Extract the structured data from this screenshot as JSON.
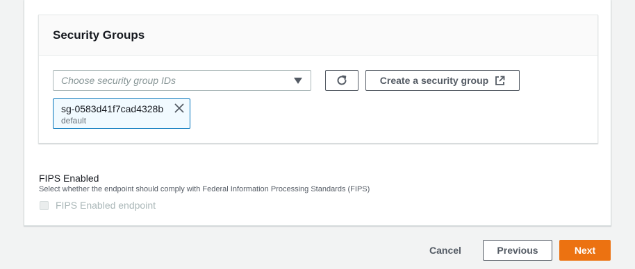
{
  "security_groups": {
    "title": "Security Groups",
    "select": {
      "placeholder": "Choose security group IDs"
    },
    "refresh_icon": "refresh-icon",
    "create_button": {
      "label": "Create a security group",
      "icon": "external-link-icon"
    },
    "selected_tokens": [
      {
        "id": "sg-0583d41f7cad4328b",
        "description": "default",
        "remove_icon": "close-icon"
      }
    ]
  },
  "fips": {
    "title": "FIPS Enabled",
    "description": "Select whether the endpoint should comply with Federal Information Processing Standards (FIPS)",
    "checkbox_label": "FIPS Enabled endpoint",
    "checked": false,
    "disabled": true
  },
  "footer": {
    "cancel_label": "Cancel",
    "previous_label": "Previous",
    "next_label": "Next"
  },
  "colors": {
    "primary_button": "#ec7211",
    "token_border": "#0073bb",
    "token_background": "#f1faff",
    "page_background": "#f2f3f3"
  }
}
